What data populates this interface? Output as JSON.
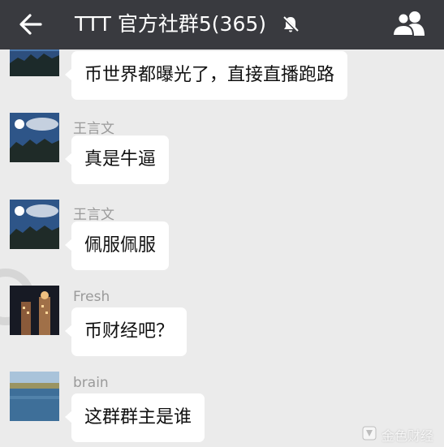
{
  "header": {
    "title": "TTT 官方社群5(365)",
    "back_icon": "back-arrow-icon",
    "mute_icon": "mute-bell-icon",
    "group_icon": "group-members-icon",
    "background": "#393a3f"
  },
  "messages": [
    {
      "sender": "",
      "text": "币世界都曝光了，直接直播跑路",
      "avatar": "sky-sun"
    },
    {
      "sender": "王言文",
      "text": "真是牛逼",
      "avatar": "sky-sun"
    },
    {
      "sender": "王言文",
      "text": "佩服佩服",
      "avatar": "sky-sun"
    },
    {
      "sender": "Fresh",
      "text": "币财经吧？",
      "avatar": "night-building"
    },
    {
      "sender": "brain",
      "text": "这群群主是谁",
      "avatar": "lake"
    }
  ],
  "watermark": {
    "text": "金色财经"
  },
  "colors": {
    "chat_background": "#ebebeb",
    "bubble": "#ffffff",
    "sender_name": "#9a9a9a"
  }
}
